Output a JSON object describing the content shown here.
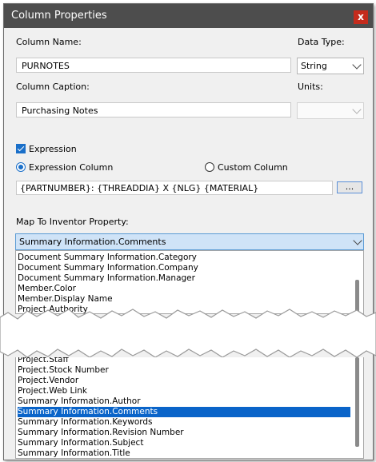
{
  "dialog": {
    "title": "Column Properties",
    "close_label": "x"
  },
  "labels": {
    "column_name": "Column Name:",
    "data_type": "Data Type:",
    "column_caption": "Column Caption:",
    "units": "Units:",
    "map_to_property": "Map To Inventor Property:"
  },
  "fields": {
    "column_name_value": "PURNOTES",
    "column_caption_value": "Purchasing Notes",
    "data_type_value": "String",
    "units_value": "",
    "expression_value": "{PARTNUMBER}: {THREADDIA} X {NLG} {MATERIAL}"
  },
  "expression": {
    "checkbox_label": "Expression",
    "checked": true
  },
  "column_mode": {
    "expression_label": "Expression Column",
    "custom_label": "Custom Column",
    "selected": "Expression Column"
  },
  "browse_button": {
    "label": "..."
  },
  "property_combo": {
    "selected": "Summary Information.Comments"
  },
  "dropdown_top": [
    "Document Summary Information.Category",
    "Document Summary Information.Company",
    "Document Summary Information.Manager",
    "Member.Color",
    "Member.Display Name",
    "Project.Authority"
  ],
  "dropdown_bottom": [
    "Project.Staff",
    "Project.Stock Number",
    "Project.Vendor",
    "Project.Web Link",
    "Summary Information.Author",
    "Summary Information.Comments",
    "Summary Information.Keywords",
    "Summary Information.Revision Number",
    "Summary Information.Subject",
    "Summary Information.Title"
  ],
  "colors": {
    "titlebar": "#4d4d4d",
    "close": "#c42b1c",
    "accent": "#0a64c9",
    "dialog_bg": "#f0f0f0"
  }
}
